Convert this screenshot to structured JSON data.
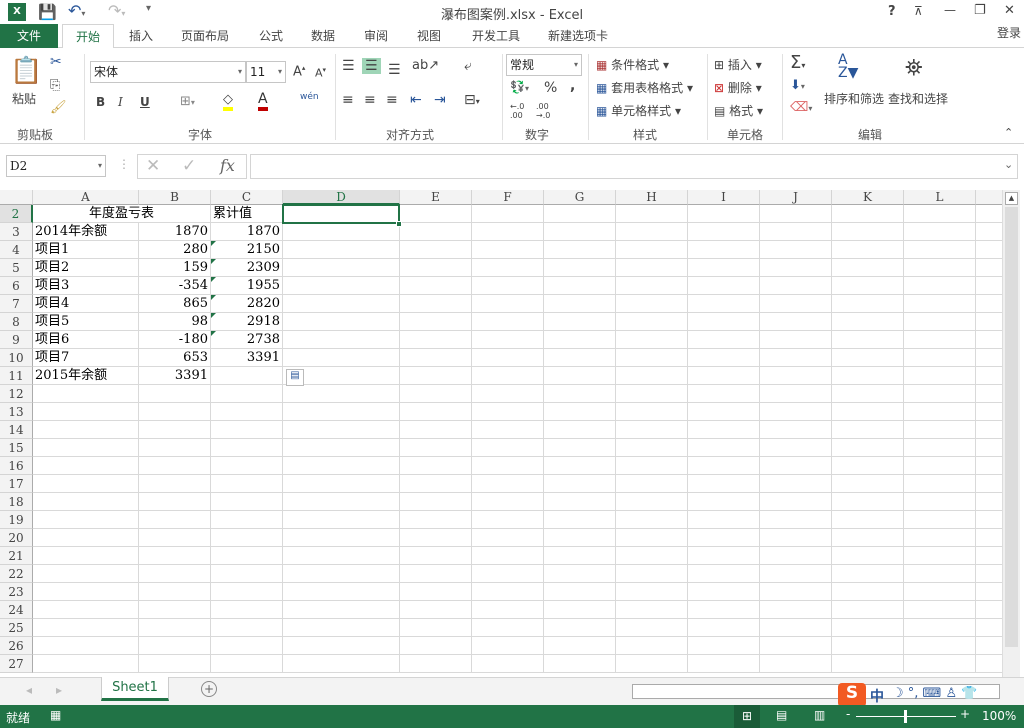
{
  "title": "瀑布图案例.xlsx - Excel",
  "window_controls": {
    "help": "?",
    "ribbon_display": "⊼",
    "minimize": "—",
    "restore": "❐",
    "close": "✕"
  },
  "tabs": {
    "file": "文件",
    "items": [
      "开始",
      "插入",
      "页面布局",
      "公式",
      "数据",
      "审阅",
      "视图",
      "开发工具",
      "新建选项卡"
    ],
    "active": 0,
    "login": "登录"
  },
  "ribbon": {
    "clipboard": {
      "paste": "粘贴",
      "label": "剪贴板"
    },
    "font": {
      "name": "宋体",
      "size": "11",
      "bold": "B",
      "italic": "I",
      "underline": "U",
      "phonetic": "wén",
      "label": "字体",
      "fill_color": "#ffff00",
      "font_color": "#c00000"
    },
    "alignment": {
      "label": "对齐方式"
    },
    "number": {
      "format": "常规",
      "percent": "%",
      "comma": ",",
      "label": "数字"
    },
    "styles": {
      "conditional": "条件格式",
      "table": "套用表格格式",
      "cell_styles": "单元格样式",
      "label": "样式"
    },
    "cells": {
      "insert": "插入",
      "delete": "删除",
      "format": "格式",
      "label": "单元格"
    },
    "editing": {
      "sort": "排序和筛选",
      "find": "查找和选择",
      "label": "编辑"
    }
  },
  "formula_bar": {
    "name_box": "D2",
    "fx": "fx",
    "value": ""
  },
  "columns": [
    "A",
    "B",
    "C",
    "D",
    "E",
    "F",
    "G",
    "H",
    "I",
    "J",
    "K",
    "L",
    ""
  ],
  "rows": [
    {
      "n": "2",
      "a": "年度盈亏表",
      "b": "",
      "c": "累计值",
      "merged": true
    },
    {
      "n": "3",
      "a": "2014年余额",
      "b": "1870",
      "c": "1870"
    },
    {
      "n": "4",
      "a": "项目1",
      "b": "280",
      "c": "2150",
      "flag": true
    },
    {
      "n": "5",
      "a": "项目2",
      "b": "159",
      "c": "2309",
      "flag": true
    },
    {
      "n": "6",
      "a": "项目3",
      "b": "-354",
      "c": "1955",
      "flag": true
    },
    {
      "n": "7",
      "a": "项目4",
      "b": "865",
      "c": "2820",
      "flag": true
    },
    {
      "n": "8",
      "a": "项目5",
      "b": "98",
      "c": "2918",
      "flag": true
    },
    {
      "n": "9",
      "a": "项目6",
      "b": "-180",
      "c": "2738",
      "flag": true
    },
    {
      "n": "10",
      "a": "项目7",
      "b": "653",
      "c": "3391"
    },
    {
      "n": "11",
      "a": "2015年余额",
      "b": "3391",
      "c": ""
    },
    {
      "n": "12"
    },
    {
      "n": "13"
    },
    {
      "n": "14"
    },
    {
      "n": "15"
    },
    {
      "n": "16"
    },
    {
      "n": "17"
    },
    {
      "n": "18"
    },
    {
      "n": "19"
    },
    {
      "n": "20"
    },
    {
      "n": "21"
    },
    {
      "n": "22"
    },
    {
      "n": "23"
    },
    {
      "n": "24"
    },
    {
      "n": "25"
    },
    {
      "n": "26"
    },
    {
      "n": "27"
    }
  ],
  "selected_cell": "D2",
  "sheets": [
    "Sheet1"
  ],
  "status": {
    "ready": "就绪",
    "zoom": "100%"
  },
  "ime": {
    "logo": "S",
    "mode": "中"
  },
  "colors": {
    "accent": "#217346"
  }
}
